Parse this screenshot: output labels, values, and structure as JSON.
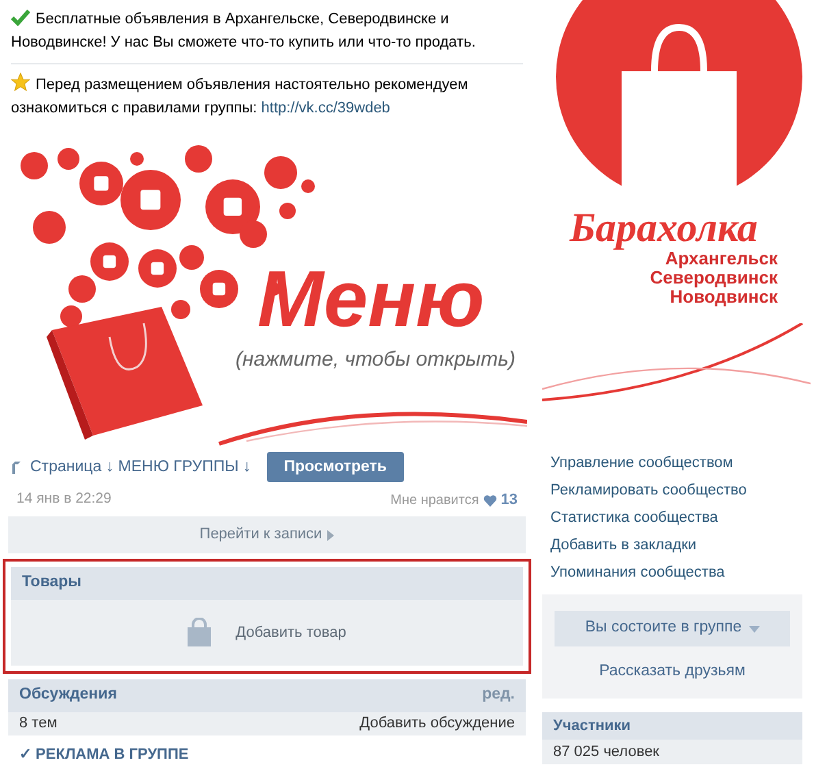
{
  "post": {
    "paragraphs": [
      {
        "text": "Бесплатные объявления в Архангельске, Северодвинске и Новодвинске! У нас Вы сможете что-то купить или что-то продать."
      },
      {
        "text": "Перед размещением объявления настоятельно рекомендуем ознакомиться с правилами группы:",
        "link": "http://vk.cc/39wdeb"
      }
    ],
    "banner": {
      "title": "Меню",
      "subtitle": "(нажмите, чтобы открыть)"
    },
    "attachment": {
      "label": "Страница ↓ МЕНЮ ГРУППЫ ↓",
      "button": "Просмотреть"
    },
    "date": "14 янв в 22:29",
    "likes": {
      "label": "Мне нравится",
      "count": "13"
    },
    "go_to_post": "Перейти к записи"
  },
  "goods": {
    "title": "Товары",
    "action": "Добавить товар",
    "highlighted": true
  },
  "discussions": {
    "title": "Обсуждения",
    "edit": "ред.",
    "count": "8 тем",
    "action": "Добавить обсуждение"
  },
  "next_post_title": "✓ РЕКЛАМА В ГРУППЕ",
  "logo": {
    "title": "Барахолка",
    "cities": [
      "Архангельск",
      "Северодвинск",
      "Новодвинск"
    ]
  },
  "sidebar": {
    "items": [
      "Управление сообществом",
      "Рекламировать сообщество",
      "Статистика сообщества",
      "Добавить в закладки",
      "Упоминания сообщества"
    ],
    "membership_button": "Вы состоите в группе",
    "share": "Рассказать друзьям",
    "members": {
      "title": "Участники",
      "count": "87 025 человек"
    }
  }
}
